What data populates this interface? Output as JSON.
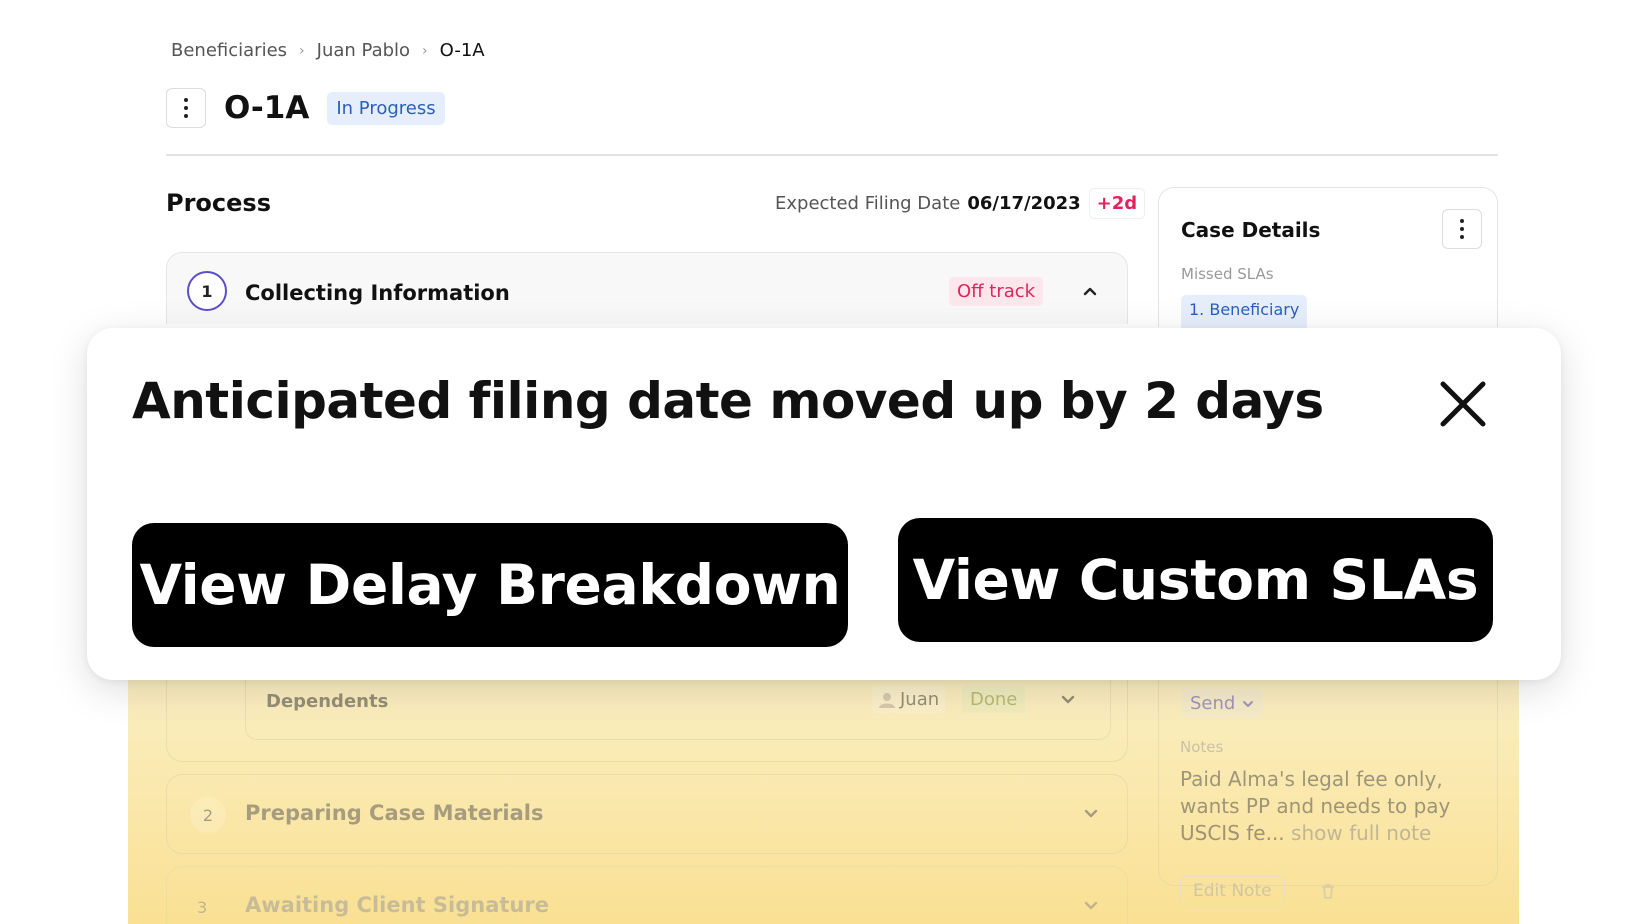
{
  "breadcrumb": {
    "items": [
      "Beneficiaries",
      "Juan Pablo",
      "O-1A"
    ]
  },
  "header": {
    "title": "O-1A",
    "status": "In Progress"
  },
  "process": {
    "title": "Process",
    "filing_label": "Expected Filing Date",
    "filing_date": "06/17/2023",
    "filing_delta": "+2d",
    "steps": [
      {
        "number": "1",
        "label": "Collecting Information",
        "status": "Off track"
      },
      {
        "number": "2",
        "label": "Preparing Case Materials"
      },
      {
        "number": "3",
        "label": "Awaiting Client Signature"
      }
    ],
    "dependents": {
      "label": "Dependents",
      "assignee": "Juan",
      "status": "Done"
    }
  },
  "case_details": {
    "title": "Case Details",
    "missed_slas_label": "Missed SLAs",
    "missed_slas": [
      "1. Beneficiary"
    ],
    "send_label": "Send",
    "notes_label": "Notes",
    "notes_text": "Paid Alma's legal fee only, wants PP and needs to pay USCIS fe...",
    "show_full_note": "show full note",
    "edit_note": "Edit Note"
  },
  "toast": {
    "message": "Anticipated filing date moved up by 2 days",
    "primary_action": "View Delay Breakdown",
    "secondary_action": "View Custom SLAs"
  },
  "colors": {
    "accent_blue": "#2b5fb9",
    "off_track_red": "#e0245e",
    "step_ring_purple": "#5a4fc7",
    "toast_button_black": "#000000",
    "highlight_yellow": "#f9e093"
  },
  "icons": [
    "more-vertical-icon",
    "chevron-right-icon",
    "chevron-up-icon",
    "chevron-down-icon",
    "user-icon",
    "trash-icon",
    "close-icon"
  ]
}
